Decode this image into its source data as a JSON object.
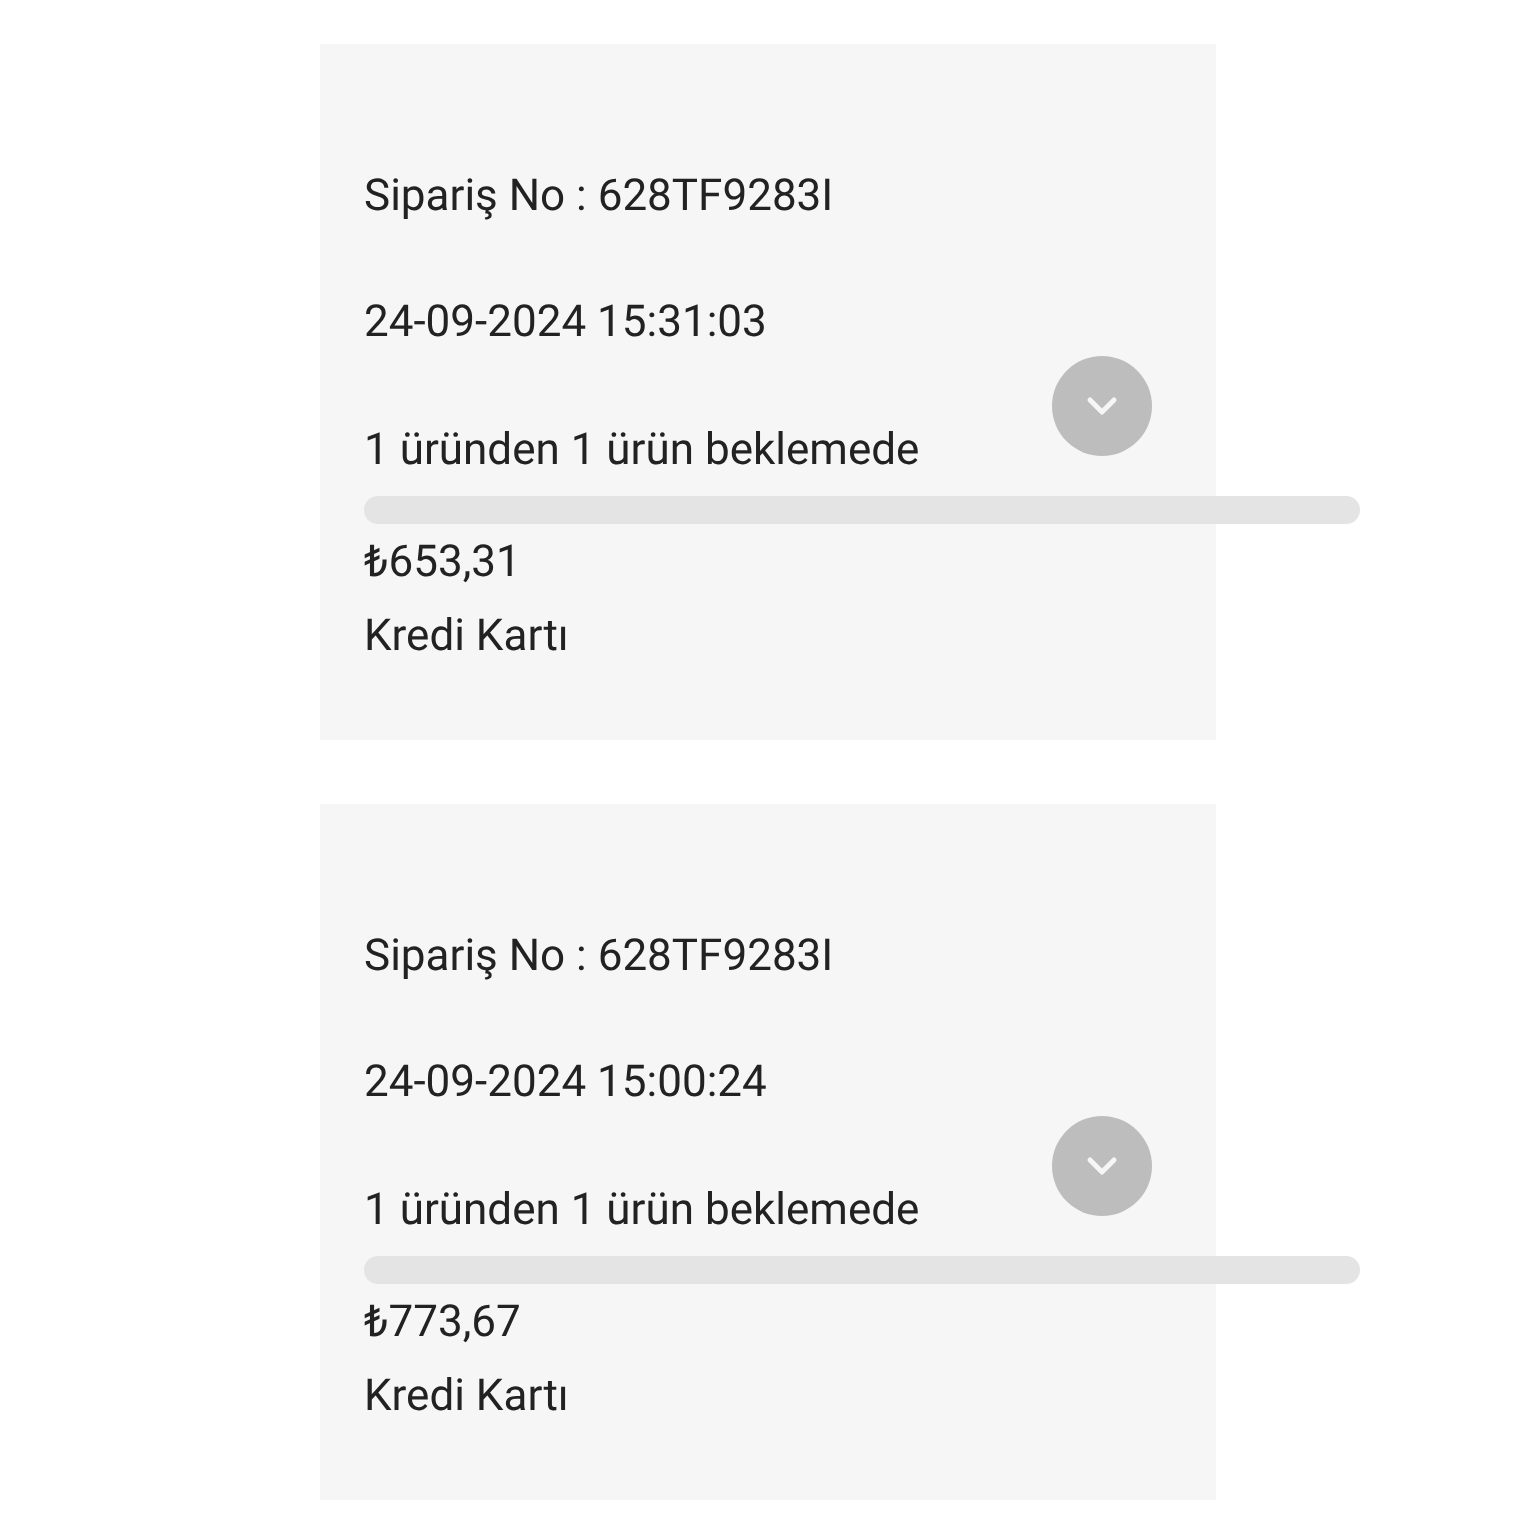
{
  "orders": [
    {
      "order_no": "Sipariş No : 628TF9283I",
      "date": "24-09-2024 15:31:03",
      "status": "1 üründen 1 ürün beklemede",
      "expanded": false,
      "total": "₺653,31",
      "payment": "Kredi Kartı"
    },
    {
      "order_no": "Sipariş No : 628TF9283I",
      "date": "24-09-2024 15:00:24",
      "status": "1 üründen 1 ürün beklemede",
      "expanded": false,
      "total": "₺773,67",
      "payment": "Kredi Kartı"
    }
  ]
}
